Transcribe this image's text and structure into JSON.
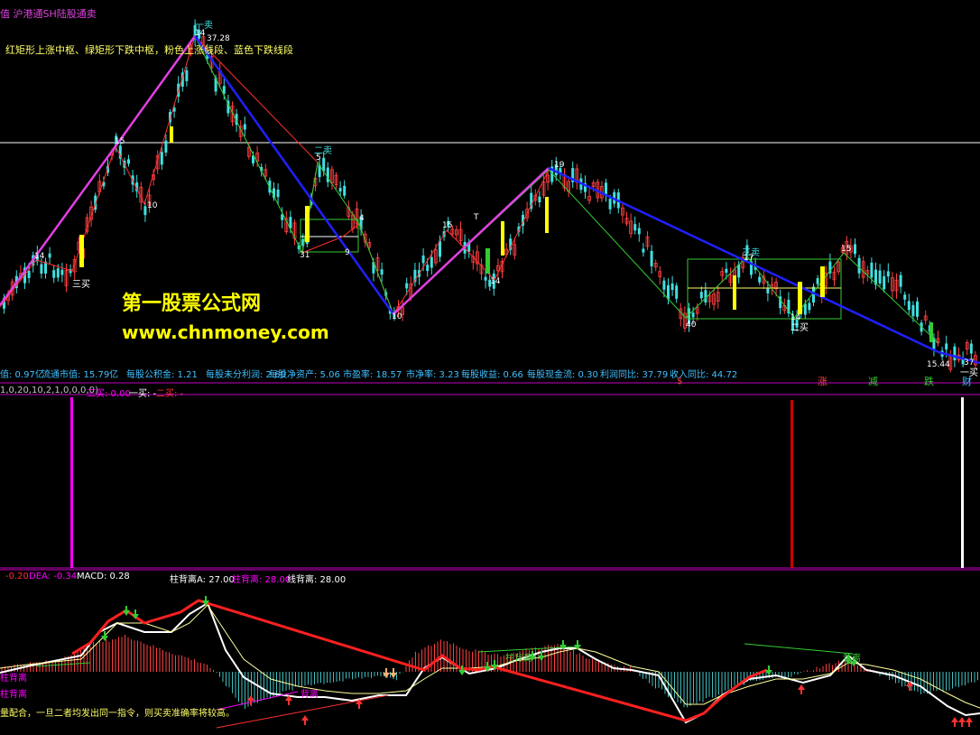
{
  "colors": {
    "background": "#000000",
    "up_candle": "#ff4040",
    "down_candle": "#40e0e0",
    "zhongshu_up": "#ff3030",
    "zhongshu_down": "#33cc33",
    "line_up": "#e040e0",
    "line_down": "#2020ff",
    "yellow_bar": "#ffff00",
    "magenta": "#ff00ff",
    "red_bar": "#cc0000",
    "white": "#ffffff"
  },
  "main_panel": {
    "indicator_title": "值 沪港通SH陆股通卖",
    "legend_note": "红矩形上涨中枢、绿矩形下跌中枢，粉色上涨线段、蓝色下跌线段",
    "watermark_cn": "第一股票公式网",
    "watermark_url": "www.chnmoney.com",
    "labels": {
      "top_sell": "一卖",
      "top_value": "37.28",
      "top_index": "14",
      "n15_left": "15",
      "n10_left": "10",
      "n14_left": "14",
      "buy3_left": "三买",
      "sell2": "二卖",
      "n5": "5",
      "n31": "31",
      "n9": "9",
      "n4": "4",
      "n10_bottom": "10",
      "n15_mid": "15",
      "t_mark": "T",
      "n14_mid": "14",
      "n19": "19",
      "sell3": "三卖",
      "n17": "17",
      "n40": "40",
      "n14_right": "14",
      "buy2": "二买",
      "n15_right": "15",
      "low_value": "15.44",
      "arrow_37": "37",
      "buy1_right": "一买"
    }
  },
  "fin_strip": {
    "items": [
      "值: 0.97亿",
      "流通市值: 15.79亿",
      "每股公积金: 1.21",
      "每股未分利润: 2.60",
      "每股净资产: 5.06",
      "市盈率: 18.57",
      "市净率: 3.23",
      "每股收益: 0.66",
      "每股现金流: 0.30",
      "利润同比: 37.79",
      "收入同比: 44.72"
    ],
    "right_tags": [
      "$",
      "涨",
      "减",
      "跌",
      "财"
    ]
  },
  "signal_panel": {
    "params": "1,0,20,10,2,1,0,0,0,0)",
    "buy3_label": "三买: 0.00",
    "buy1_label": "一买: -",
    "buy2_label": "二买: -"
  },
  "macd_panel": {
    "diff_label": "-0.20",
    "dea_label": "DEA: -0.34",
    "macd_label": "MACD: 0.28",
    "bar_div_a": "柱背离A: 27.00",
    "bar_div": "柱背离: 28.00",
    "line_div": "线背离: 28.00",
    "bottom_note": "量配合，一旦二者均发出同一指令，则买卖准确率将较高。",
    "div_tag": "柱背离",
    "div_tag2": "柱背离",
    "div_tag3": "背离",
    "div_tag4": "柱背离",
    "div_tag5": "背离"
  }
}
